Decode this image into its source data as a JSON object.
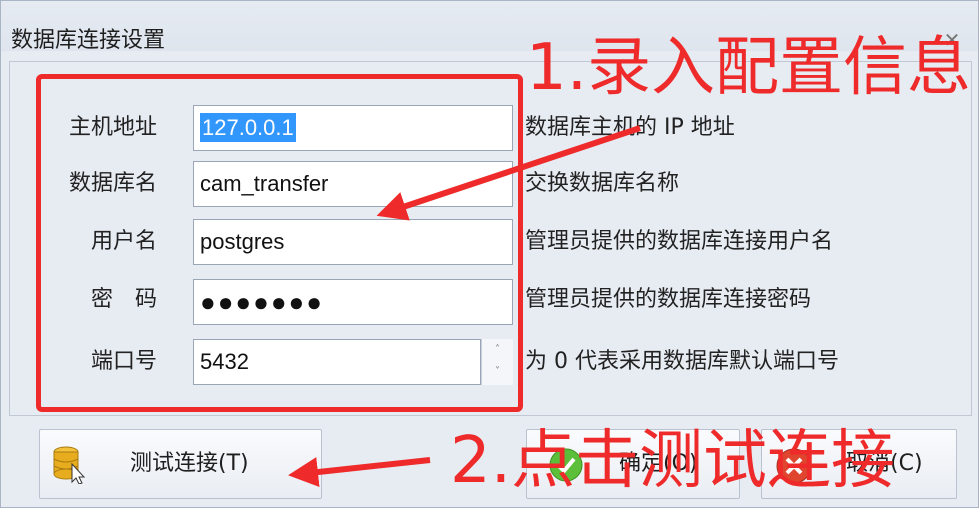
{
  "window": {
    "title": "数据库连接设置",
    "close_glyph": "✕"
  },
  "form": {
    "host": {
      "label": "主机地址",
      "value": "127.0.0.1",
      "hint": "数据库主机的 IP 地址"
    },
    "dbname": {
      "label": "数据库名",
      "value": "cam_transfer",
      "hint": "交换数据库名称"
    },
    "user": {
      "label": "用户名",
      "value": "postgres",
      "hint": "管理员提供的数据库连接用户名"
    },
    "password": {
      "label": "密　码",
      "value": "●●●●●●●",
      "hint": "管理员提供的数据库连接密码"
    },
    "port": {
      "label": "端口号",
      "value": "5432",
      "hint": "为 0 代表采用数据库默认端口号",
      "spin_up": "˄",
      "spin_down": "˅"
    }
  },
  "buttons": {
    "test": "测试连接(T)",
    "ok": "确定(O)",
    "cancel": "取消(C)"
  },
  "annotations": {
    "step1": "1.录入配置信息",
    "step2": "2.点击测试连接",
    "color": "#ee2a2a"
  },
  "icons": {
    "test": "database-icon",
    "ok": "checkmark-icon",
    "cancel": "cancel-icon"
  }
}
